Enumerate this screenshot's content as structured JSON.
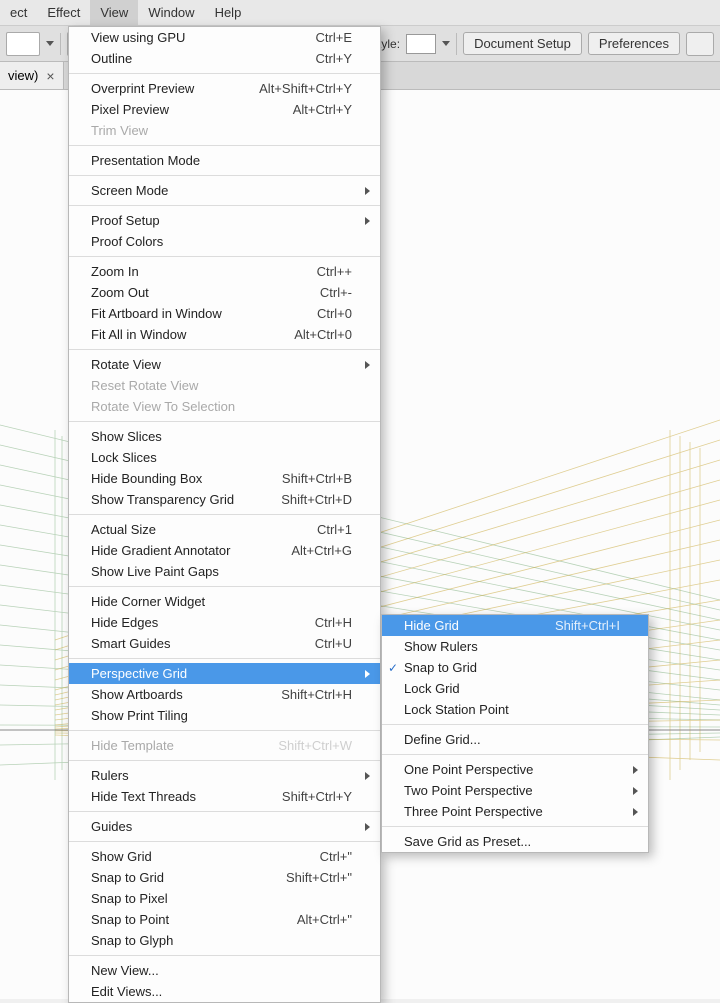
{
  "menubar": {
    "items": [
      "ect",
      "Effect",
      "View",
      "Window",
      "Help"
    ],
    "active": "View"
  },
  "toolbar": {
    "style_label": "Style:",
    "doc_setup": "Document Setup",
    "preferences": "Preferences"
  },
  "tab": {
    "title": "view)",
    "close": "×"
  },
  "view_menu": {
    "g0": [
      {
        "label": "View using GPU",
        "shortcut": "Ctrl+E"
      },
      {
        "label": "Outline",
        "shortcut": "Ctrl+Y"
      }
    ],
    "g1": [
      {
        "label": "Overprint Preview",
        "shortcut": "Alt+Shift+Ctrl+Y"
      },
      {
        "label": "Pixel Preview",
        "shortcut": "Alt+Ctrl+Y"
      },
      {
        "label": "Trim View",
        "disabled": true
      }
    ],
    "g2": [
      {
        "label": "Presentation Mode"
      }
    ],
    "g3": [
      {
        "label": "Screen Mode",
        "submenu": true
      }
    ],
    "g4": [
      {
        "label": "Proof Setup",
        "submenu": true
      },
      {
        "label": "Proof Colors"
      }
    ],
    "g5": [
      {
        "label": "Zoom In",
        "shortcut": "Ctrl++"
      },
      {
        "label": "Zoom Out",
        "shortcut": "Ctrl+-"
      },
      {
        "label": "Fit Artboard in Window",
        "shortcut": "Ctrl+0"
      },
      {
        "label": "Fit All in Window",
        "shortcut": "Alt+Ctrl+0"
      }
    ],
    "g6": [
      {
        "label": "Rotate View",
        "submenu": true
      },
      {
        "label": "Reset Rotate View",
        "disabled": true
      },
      {
        "label": "Rotate View To Selection",
        "disabled": true
      }
    ],
    "g7": [
      {
        "label": "Show Slices"
      },
      {
        "label": "Lock Slices"
      },
      {
        "label": "Hide Bounding Box",
        "shortcut": "Shift+Ctrl+B"
      },
      {
        "label": "Show Transparency Grid",
        "shortcut": "Shift+Ctrl+D"
      }
    ],
    "g8": [
      {
        "label": "Actual Size",
        "shortcut": "Ctrl+1"
      },
      {
        "label": "Hide Gradient Annotator",
        "shortcut": "Alt+Ctrl+G"
      },
      {
        "label": "Show Live Paint Gaps"
      }
    ],
    "g9": [
      {
        "label": "Hide Corner Widget"
      },
      {
        "label": "Hide Edges",
        "shortcut": "Ctrl+H"
      },
      {
        "label": "Smart Guides",
        "shortcut": "Ctrl+U"
      }
    ],
    "g10": [
      {
        "label": "Perspective Grid",
        "submenu": true,
        "hover": true
      },
      {
        "label": "Show Artboards",
        "shortcut": "Shift+Ctrl+H"
      },
      {
        "label": "Show Print Tiling"
      }
    ],
    "g11": [
      {
        "label": "Hide Template",
        "shortcut": "Shift+Ctrl+W",
        "disabled": true
      }
    ],
    "g12": [
      {
        "label": "Rulers",
        "submenu": true
      },
      {
        "label": "Hide Text Threads",
        "shortcut": "Shift+Ctrl+Y"
      }
    ],
    "g13": [
      {
        "label": "Guides",
        "submenu": true
      }
    ],
    "g14": [
      {
        "label": "Show Grid",
        "shortcut": "Ctrl+\""
      },
      {
        "label": "Snap to Grid",
        "shortcut": "Shift+Ctrl+\""
      },
      {
        "label": "Snap to Pixel"
      },
      {
        "label": "Snap to Point",
        "shortcut": "Alt+Ctrl+\""
      },
      {
        "label": "Snap to Glyph"
      }
    ],
    "g15": [
      {
        "label": "New View..."
      },
      {
        "label": "Edit Views..."
      }
    ]
  },
  "submenu": {
    "s0": [
      {
        "label": "Hide Grid",
        "shortcut": "Shift+Ctrl+I",
        "hover": true
      },
      {
        "label": "Show Rulers"
      },
      {
        "label": "Snap to Grid",
        "checked": true
      },
      {
        "label": "Lock Grid"
      },
      {
        "label": "Lock Station Point"
      }
    ],
    "s1": [
      {
        "label": "Define Grid..."
      }
    ],
    "s2": [
      {
        "label": "One Point Perspective",
        "submenu": true
      },
      {
        "label": "Two Point Perspective",
        "submenu": true
      },
      {
        "label": "Three Point Perspective",
        "submenu": true
      }
    ],
    "s3": [
      {
        "label": "Save Grid as Preset..."
      }
    ]
  }
}
